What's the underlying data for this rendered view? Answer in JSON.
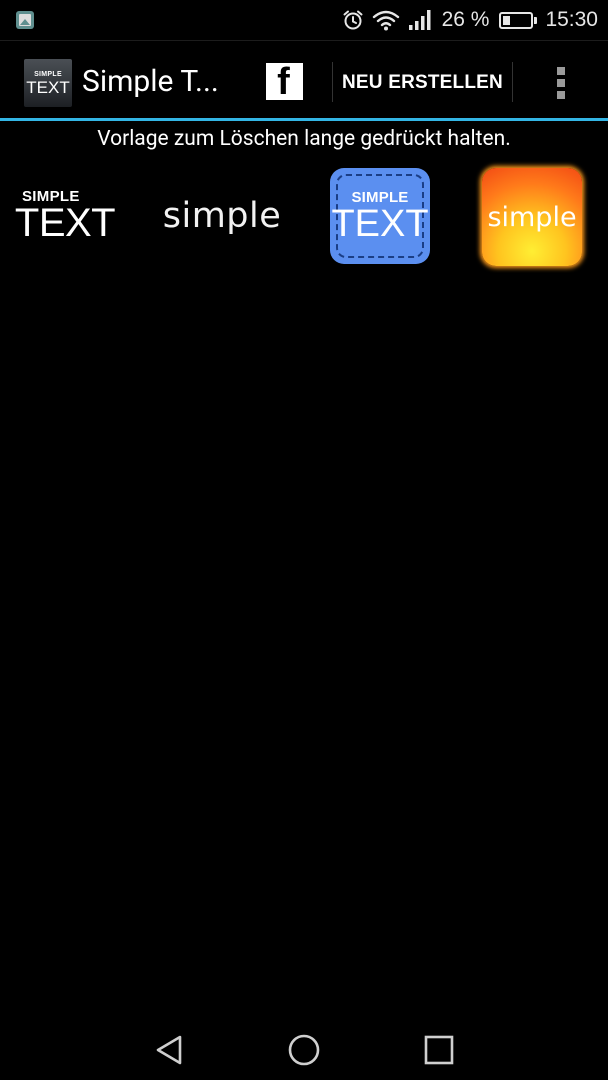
{
  "status_bar": {
    "battery_percent_text": "26 %",
    "battery_level": 0.26,
    "time": "15:30",
    "notification_icon": "gallery-icon",
    "icons": [
      "alarm-icon",
      "wifi-icon",
      "signal-icon",
      "battery-icon"
    ]
  },
  "action_bar": {
    "app_logo": {
      "line1": "SIMPLE",
      "line2": "TEXT"
    },
    "title": "Simple T...",
    "facebook_label": "f",
    "new_button_label": "NEU ERSTELLEN",
    "overflow_icon": "more-vert-icon",
    "accent_color": "#33b5e5"
  },
  "hint_text": "Vorlage zum Löschen lange gedrückt halten.",
  "templates": [
    {
      "line1": "SIMPLE",
      "line2": "TEXT"
    },
    {
      "text": "simple"
    },
    {
      "line1": "SIMPLE",
      "line2": "TEXT",
      "color": "#5b8ff0"
    },
    {
      "text": "simple",
      "color": "#ff8a1a"
    }
  ],
  "nav_bar": {
    "icons": [
      "back-icon",
      "home-icon",
      "recents-icon"
    ]
  }
}
